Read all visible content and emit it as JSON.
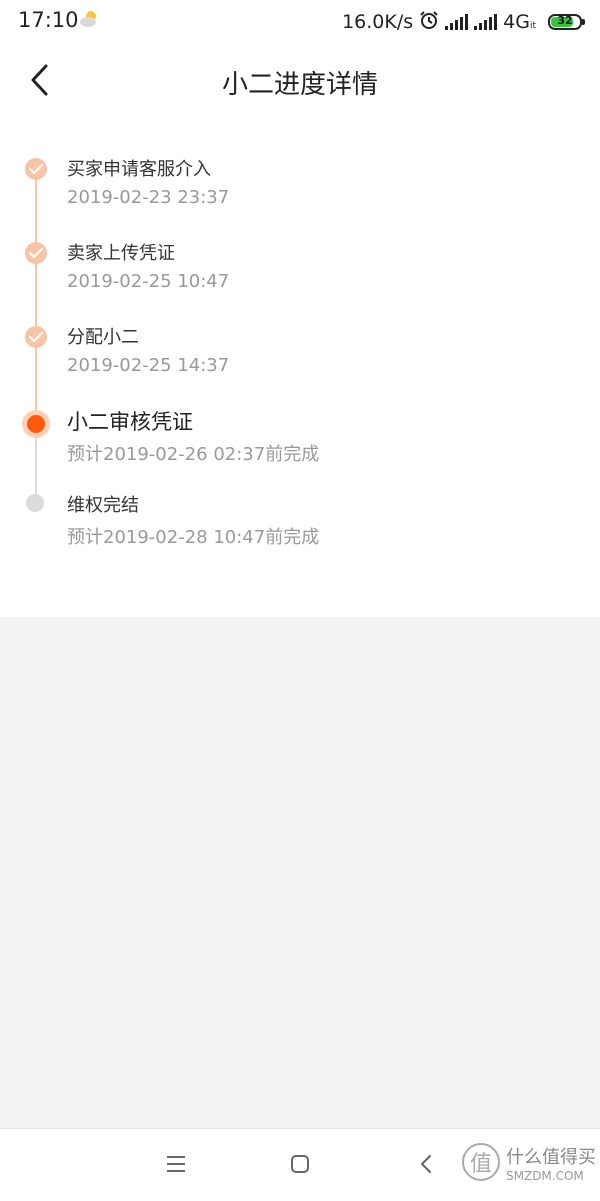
{
  "status_bar": {
    "time": "17:10",
    "weather_icon": "partly-cloudy-icon",
    "network_speed": "16.0K/s",
    "alarm_icon": "alarm-clock-icon",
    "network_type": "4G",
    "network_sub": "it",
    "battery": "32"
  },
  "header": {
    "back_icon": "chevron-left-icon",
    "title": "小二进度详情"
  },
  "timeline": {
    "steps": [
      {
        "title": "买家申请客服介入",
        "time": "2019-02-23 23:37",
        "state": "done"
      },
      {
        "title": "卖家上传凭证",
        "time": "2019-02-25 10:47",
        "state": "done"
      },
      {
        "title": "分配小二",
        "time": "2019-02-25 14:37",
        "state": "done"
      },
      {
        "title": "小二审核凭证",
        "time": "预计2019-02-26 02:37前完成",
        "state": "current"
      },
      {
        "title": "维权完结",
        "time": "预计2019-02-28 10:47前完成",
        "state": "pending"
      }
    ],
    "colors": {
      "done": "#f8c4a6",
      "current": "#ff5a0b",
      "pending": "#dcdcdc"
    }
  },
  "nav_bar": {
    "menu_icon": "menu-icon",
    "home_icon": "home-square-icon",
    "back_icon": "back-triangle-icon"
  },
  "watermark": {
    "glyph": "值",
    "text": "什么值得买",
    "domain": "SMZDM.COM"
  }
}
